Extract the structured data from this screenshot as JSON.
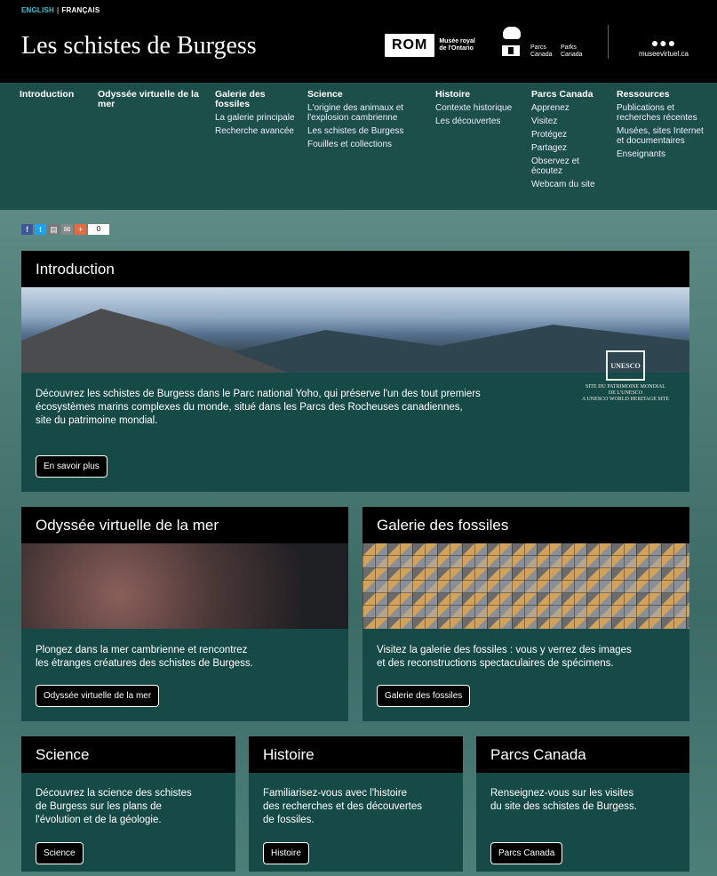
{
  "header": {
    "lang_en": "ENGLISH",
    "lang_sep": "|",
    "lang_fr": "FRANÇAIS",
    "site_title": "Les schistes de Burgess",
    "rom_logo_text": "ROM",
    "rom_caption_1": "Musée royal",
    "rom_caption_2": "de l'Ontario",
    "parks_1a": "Parcs",
    "parks_1b": "Canada",
    "parks_2a": "Parks",
    "parks_2b": "Canada",
    "mvc_dots": "●●●",
    "mvc_site": "museevirtuel.ca"
  },
  "nav": [
    {
      "head": "Introduction",
      "items": []
    },
    {
      "head": "Odyssée virtuelle de la mer",
      "items": []
    },
    {
      "head": "Galerie des fossiles",
      "items": [
        "La galerie principale",
        "Recherche avancée"
      ]
    },
    {
      "head": "Science",
      "items": [
        "L'origine des animaux et l'explosion cambrienne",
        "Les schistes de Burgess",
        "Fouilles et collections"
      ]
    },
    {
      "head": "Histoire",
      "items": [
        "Contexte historique",
        "Les découvertes"
      ]
    },
    {
      "head": "Parcs Canada",
      "items": [
        "Apprenez",
        "Visitez",
        "Protégez",
        "Partagez",
        "Observez et écoutez",
        "Webcam du site"
      ]
    },
    {
      "head": "Ressources",
      "items": [
        "Publications et recherches récentes",
        "Musées, sites Internet et documentaires",
        "Enseignants"
      ]
    }
  ],
  "share": {
    "count": "0",
    "plus": "+"
  },
  "cards": {
    "intro": {
      "title": "Introduction",
      "text_1": "Découvrez les schistes de Burgess dans le Parc national Yoho, qui préserve l'un des tout premiers",
      "text_2": "écosystèmes marins complexes du monde, situé dans les Parcs des Rocheuses canadiennes,",
      "text_3": "site du patrimoine mondial.",
      "button": "En savoir plus",
      "unesco_1": "SITE DU PATRIMOINE MONDIAL",
      "unesco_2": "DE L'UNESCO",
      "unesco_3": "A UNESCO WORLD HERITAGE SITE",
      "unesco_sym": "UNESCO"
    },
    "odyssey": {
      "title": "Odyssée virtuelle de la mer",
      "text_1": "Plongez dans la mer cambrienne et rencontrez",
      "text_2": "les étranges créatures des schistes de Burgess.",
      "button": "Odyssée virtuelle de la mer"
    },
    "gallery": {
      "title": "Galerie des fossiles",
      "text_1": "Visitez la galerie des fossiles : vous y verrez des images",
      "text_2": "et des reconstructions spectaculaires de spécimens.",
      "button": "Galerie des fossiles"
    },
    "science": {
      "title": "Science",
      "text_1": "Découvrez la science des schistes",
      "text_2": "de Burgess sur les plans de",
      "text_3": "l'évolution et de la géologie.",
      "button": "Science"
    },
    "history": {
      "title": "Histoire",
      "text_1": "Familiarisez-vous avec l'histoire",
      "text_2": "des recherches et des découvertes",
      "text_3": "de fossiles.",
      "button": "Histoire"
    },
    "parks": {
      "title": "Parcs Canada",
      "text_1": "Renseignez-vous sur les visites",
      "text_2": "du site des schistes de Burgess.",
      "button": "Parcs Canada"
    }
  }
}
